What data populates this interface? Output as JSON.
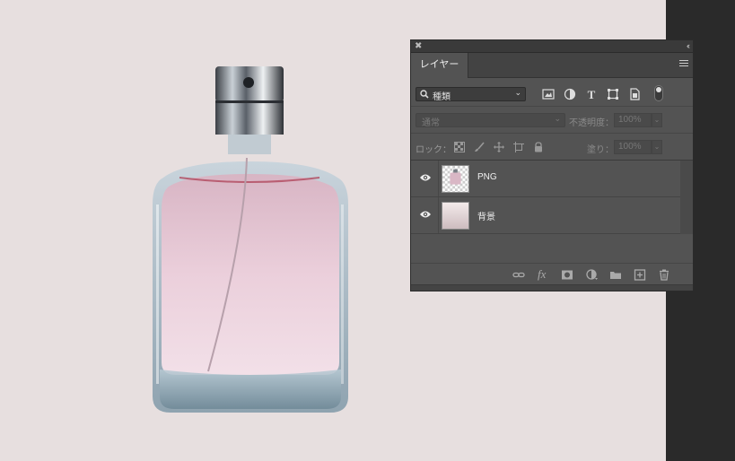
{
  "panel": {
    "tab_label": "レイヤー",
    "filter": {
      "kind_label": "種類"
    },
    "blend": {
      "mode": "通常",
      "opacity_label": "不透明度：",
      "opacity_value": "100%"
    },
    "lock": {
      "label": "ロック：",
      "fill_label": "塗り：",
      "fill_value": "100%"
    },
    "layers": [
      {
        "name": "PNG",
        "visible": true
      },
      {
        "name": "背景",
        "visible": true
      }
    ],
    "footer_icons": [
      "link-icon",
      "fx-icon",
      "mask-icon",
      "adjustment-icon",
      "folder-icon",
      "new-layer-icon",
      "trash-icon"
    ],
    "footer_fx": "fx"
  },
  "colors": {
    "canvas_bg": "#e7dfdf",
    "panel_bg": "#535353",
    "liquid": "#e3c3d0"
  }
}
